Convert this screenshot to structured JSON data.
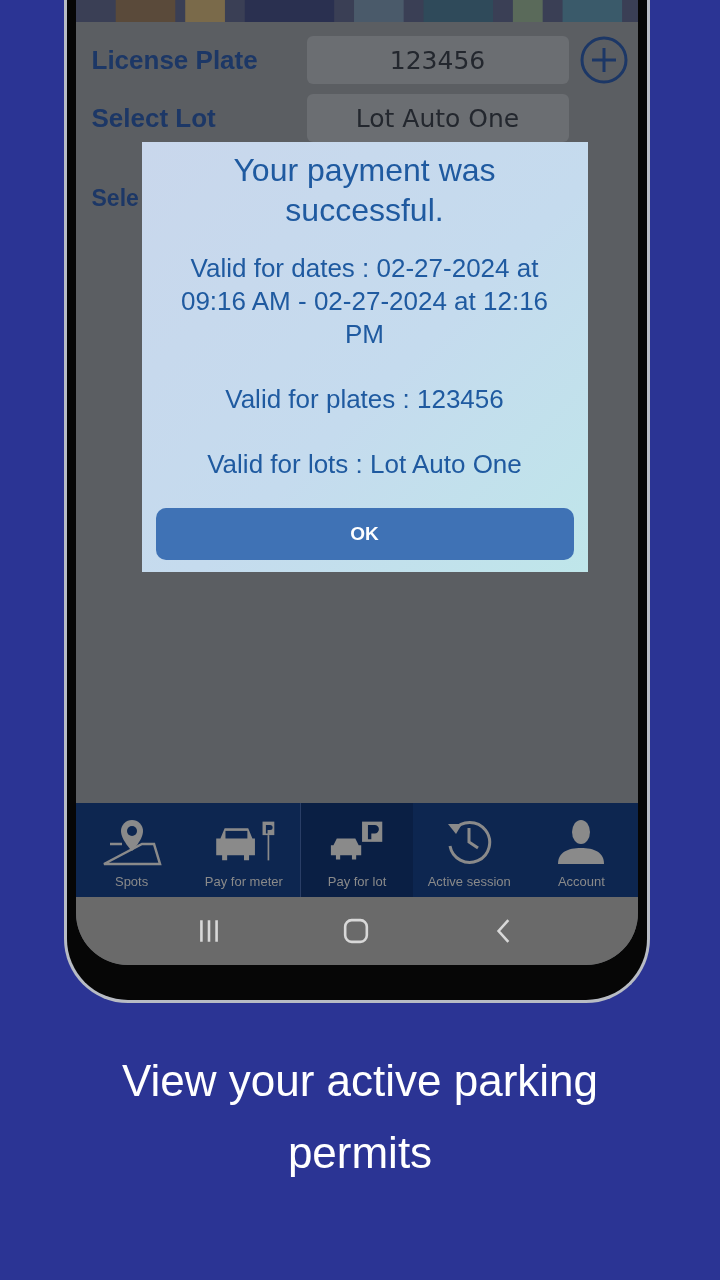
{
  "form": {
    "license_plate": {
      "label": "License Plate",
      "value": "123456"
    },
    "select_lot": {
      "label": "Select Lot",
      "value": "Lot Auto One"
    },
    "select_permit": {
      "label": "Sele"
    }
  },
  "dialog": {
    "title": "Your payment was successful.",
    "lines": [
      "Valid for dates : 02-27-2024 at 09:16 AM - 02-27-2024 at 12:16 PM",
      "Valid for plates : 123456",
      "Valid for lots : Lot Auto One"
    ],
    "button": "OK"
  },
  "tabs": [
    {
      "label": "Spots",
      "kind": "map",
      "selected": false
    },
    {
      "label": "Pay for meter",
      "kind": "meter",
      "selected": false
    },
    {
      "label": "Pay for lot",
      "kind": "lot",
      "selected": true
    },
    {
      "label": "Active session",
      "kind": "history",
      "selected": false
    },
    {
      "label": "Account",
      "kind": "account",
      "selected": false
    }
  ],
  "caption": "View your active parking permits"
}
